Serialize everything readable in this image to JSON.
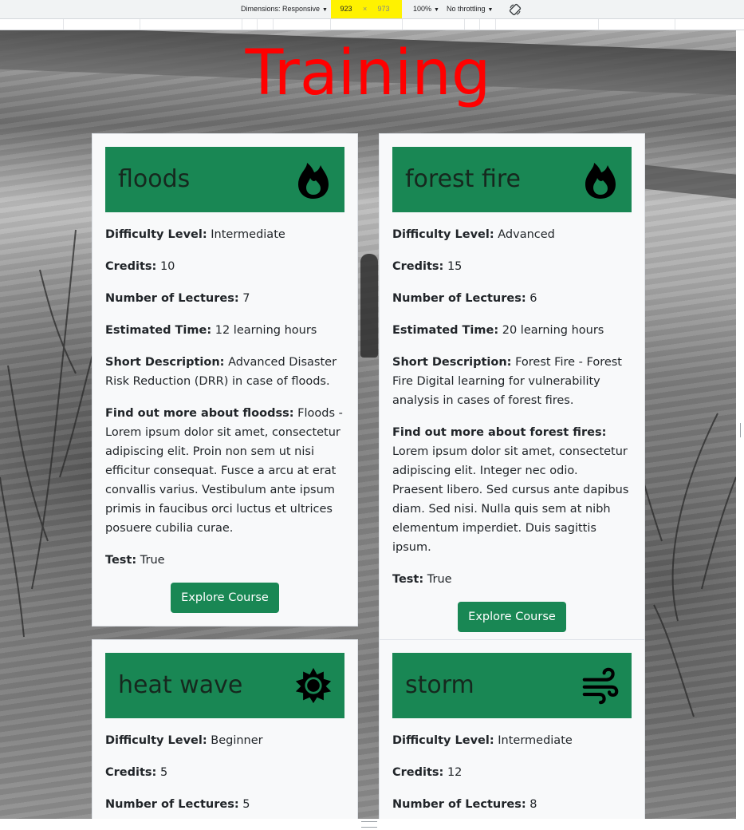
{
  "devtools": {
    "dimensions_label": "Dimensions: Responsive",
    "width_value": "923",
    "height_value": "973",
    "times_sign": "×",
    "zoom": "100%",
    "throttling": "No throttling",
    "highlight_color": "#fff200"
  },
  "page": {
    "title": "Training",
    "title_color": "#ff0000",
    "accent_color": "#198754"
  },
  "cards": [
    {
      "title": "floods",
      "icon": "fire-icon",
      "difficulty_label": "Difficulty Level:",
      "difficulty": "Intermediate",
      "credits_label": "Credits:",
      "credits": "10",
      "lectures_label": "Number of Lectures:",
      "lectures": "7",
      "time_label": "Estimated Time:",
      "time": "12 learning hours",
      "short_label": "Short Description:",
      "short": "Advanced Disaster Risk Reduction (DRR) in case of floods.",
      "more_label": "Find out more about floodss:",
      "more": "Floods - Lorem ipsum dolor sit amet, consectetur adipiscing elit. Proin non sem ut nisi efficitur consequat. Fusce a arcu at erat convallis varius. Vestibulum ante ipsum primis in faucibus orci luctus et ultrices posuere cubilia curae.",
      "test_label": "Test:",
      "test": "True",
      "button": "Explore Course"
    },
    {
      "title": "forest fire",
      "icon": "fire-icon",
      "difficulty_label": "Difficulty Level:",
      "difficulty": "Advanced",
      "credits_label": "Credits:",
      "credits": "15",
      "lectures_label": "Number of Lectures:",
      "lectures": "6",
      "time_label": "Estimated Time:",
      "time": "20 learning hours",
      "short_label": "Short Description:",
      "short": "Forest Fire - Forest Fire Digital learning for vulnerability analysis in cases of forest fires.",
      "more_label": "Find out more about forest fires:",
      "more": "Lorem ipsum dolor sit amet, consectetur adipiscing elit. Integer nec odio. Praesent libero. Sed cursus ante dapibus diam. Sed nisi. Nulla quis sem at nibh elementum imperdiet. Duis sagittis ipsum.",
      "test_label": "Test:",
      "test": "True",
      "button": "Explore Course"
    },
    {
      "title": "heat wave",
      "icon": "sun-icon",
      "difficulty_label": "Difficulty Level:",
      "difficulty": "Beginner",
      "credits_label": "Credits:",
      "credits": "5",
      "lectures_label": "Number of Lectures:",
      "lectures": "5"
    },
    {
      "title": "storm",
      "icon": "wind-icon",
      "difficulty_label": "Difficulty Level:",
      "difficulty": "Intermediate",
      "credits_label": "Credits:",
      "credits": "12",
      "lectures_label": "Number of Lectures:",
      "lectures": "8"
    }
  ]
}
